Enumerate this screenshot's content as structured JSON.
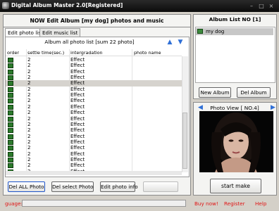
{
  "window": {
    "title": "Digital Album Master 2.0[Registered]"
  },
  "header": {
    "title": "NOW Edit Album [my dog] photos and music"
  },
  "tabs": [
    {
      "label": "Edit photo list"
    },
    {
      "label": "Edit music list"
    }
  ],
  "photo_list": {
    "caption": "Album all photo list [sum 22 photo]",
    "columns": [
      "order",
      "settle time(sec.)",
      "intergradation",
      "photo name"
    ],
    "rows": [
      {
        "time": "2",
        "effect": "Effect"
      },
      {
        "time": "2",
        "effect": "Effect"
      },
      {
        "time": "2",
        "effect": "Effect"
      },
      {
        "time": "2",
        "effect": "Effect"
      },
      {
        "time": "2",
        "effect": "Effect",
        "selected": true
      },
      {
        "time": "2",
        "effect": "Effect"
      },
      {
        "time": "2",
        "effect": "Effect"
      },
      {
        "time": "2",
        "effect": "Effect"
      },
      {
        "time": "2",
        "effect": "Effect"
      },
      {
        "time": "2",
        "effect": "Effect"
      },
      {
        "time": "2",
        "effect": "Effect"
      },
      {
        "time": "2",
        "effect": "Effect"
      },
      {
        "time": "2",
        "effect": "Effect"
      },
      {
        "time": "2",
        "effect": "Effect"
      },
      {
        "time": "2",
        "effect": "Effect"
      },
      {
        "time": "2",
        "effect": "Effect"
      },
      {
        "time": "2",
        "effect": "Effect"
      },
      {
        "time": "2",
        "effect": "Effect"
      },
      {
        "time": "2",
        "effect": "Effect"
      },
      {
        "time": "2",
        "effect": "Effect"
      }
    ]
  },
  "buttons": {
    "del_all": "Del ALL Photo",
    "del_select": "Del select Photo",
    "photo_info": "Edit photo info",
    "new_album": "New Album",
    "del_album": "Del  Album",
    "start_make": "start make"
  },
  "album_list": {
    "title": "Album List NO [1]",
    "items": [
      "my dog"
    ]
  },
  "photo_view": {
    "title": "Photo View [ NO.4]"
  },
  "status": {
    "gauge_label": "guage:",
    "links": [
      "Buy now!",
      "Register",
      "Help"
    ]
  },
  "colors": {
    "accent_blue": "#2f6fd6",
    "status_red": "#e01515",
    "order_green": "#2c7a2c"
  },
  "icons": {
    "move_up": "up-arrow-icon",
    "move_down": "down-arrow-icon",
    "prev": "left-arrow-icon",
    "next": "right-arrow-icon"
  }
}
